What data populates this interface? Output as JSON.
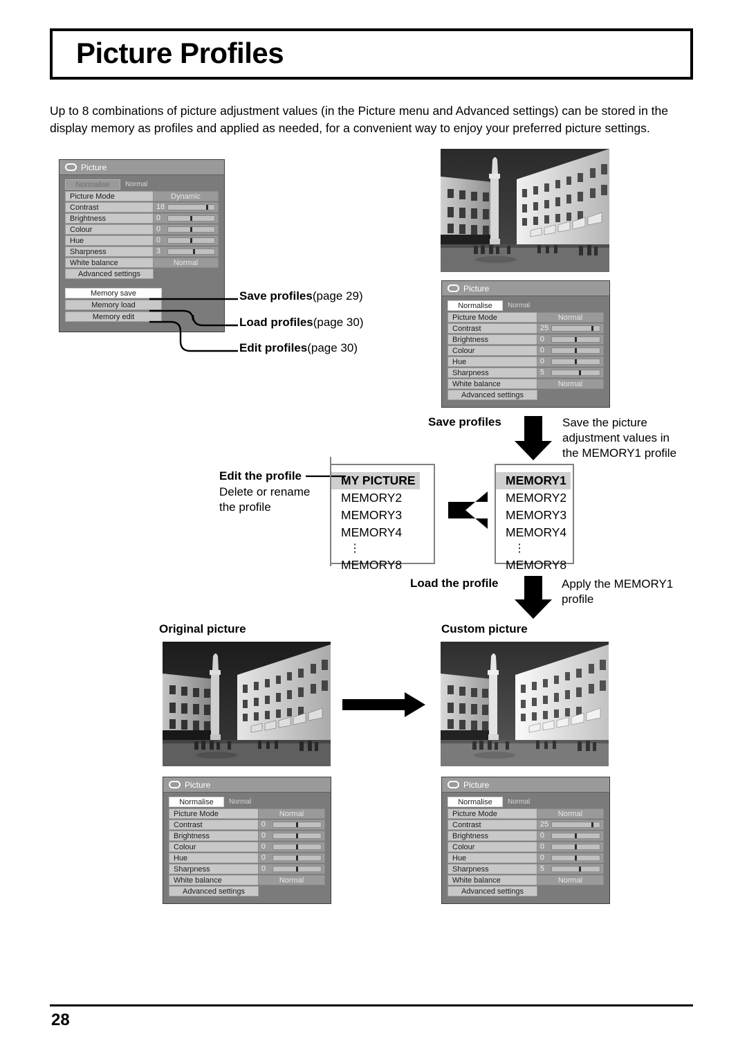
{
  "page": {
    "title": "Picture Profiles",
    "number": "28",
    "intro": "Up to 8 combinations of picture adjustment values (in the Picture menu and Advanced settings) can be stored in the display memory as profiles and applied as needed, for a convenient way to enjoy your preferred picture settings."
  },
  "osd_common": {
    "menu_title": "Picture",
    "normalise_label": "Normalise",
    "normalise_state": "Normal",
    "advanced_settings": "Advanced settings",
    "row_labels": {
      "picture_mode": "Picture Mode",
      "contrast": "Contrast",
      "brightness": "Brightness",
      "colour": "Colour",
      "hue": "Hue",
      "sharpness": "Sharpness",
      "white_balance": "White balance"
    }
  },
  "osd_panel_main": {
    "picture_mode": "Dynamic",
    "contrast": "18",
    "brightness": "0",
    "colour": "0",
    "hue": "0",
    "sharpness": "3",
    "white_balance": "Normal",
    "memory_save": "Memory save",
    "memory_load": "Memory load",
    "memory_edit": "Memory edit"
  },
  "osd_panel_saved": {
    "picture_mode": "Normal",
    "contrast": "25",
    "brightness": "0",
    "colour": "0",
    "hue": "0",
    "sharpness": "5",
    "white_balance": "Normal"
  },
  "osd_panel_original": {
    "picture_mode": "Normal",
    "contrast": "0",
    "brightness": "0",
    "colour": "0",
    "hue": "0",
    "sharpness": "0",
    "white_balance": "Normal"
  },
  "osd_panel_custom": {
    "picture_mode": "Normal",
    "contrast": "25",
    "brightness": "0",
    "colour": "0",
    "hue": "0",
    "sharpness": "5",
    "white_balance": "Normal"
  },
  "callouts": {
    "save_profiles": "Save profiles",
    "save_profiles_page": "(page 29)",
    "load_profiles": "Load profiles",
    "load_profiles_page": "(page 30)",
    "edit_profiles": "Edit profiles",
    "edit_profiles_page": "(page 30)"
  },
  "flow": {
    "save_profiles_heading": "Save profiles",
    "save_profiles_desc_1": "Save the picture",
    "save_profiles_desc_2": "adjustment values in",
    "save_profiles_desc_3": "the MEMORY1 profile",
    "edit_profile_heading": "Edit the profile",
    "edit_profile_desc_1": "Delete  or  rename",
    "edit_profile_desc_2": "the profile",
    "load_profile_heading": "Load the profile",
    "load_profile_desc_1": "Apply  the  MEMORY1",
    "load_profile_desc_2": "profile",
    "original_picture": "Original picture",
    "custom_picture": "Custom picture"
  },
  "memory_list_right": {
    "items": [
      "MEMORY1",
      "MEMORY2",
      "MEMORY3",
      "MEMORY4"
    ],
    "dots": "⋮",
    "last": "MEMORY8"
  },
  "memory_list_left": {
    "items": [
      "MY PICTURE",
      "MEMORY2",
      "MEMORY3",
      "MEMORY4"
    ],
    "dots": "⋮",
    "last": "MEMORY8"
  },
  "colors": {
    "osd_bg": "#7b7b7b",
    "osd_label": "#c8c8c8",
    "highlight": "#ffffff",
    "list_highlight": "#cfcfcf"
  }
}
